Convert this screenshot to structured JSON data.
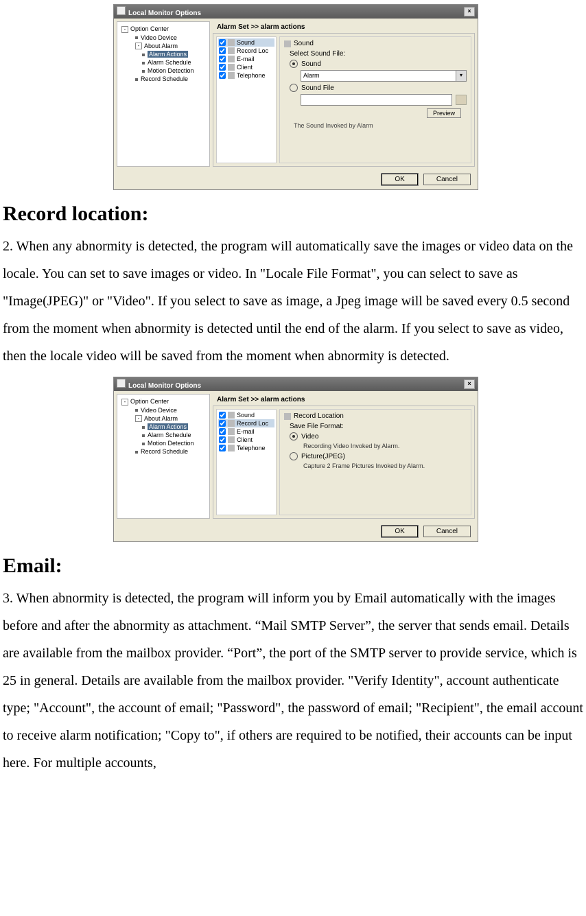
{
  "dialog1": {
    "title": "Local Monitor Options",
    "tree": {
      "root": "Option Center",
      "video_device": "Video Device",
      "about_alarm": "About Alarm",
      "alarm_actions": "Alarm Actions",
      "alarm_schedule": "Alarm Schedule",
      "motion_detection": "Motion Detection",
      "record_schedule": "Record Schedule"
    },
    "crumb": "Alarm Set >> alarm actions",
    "actions": {
      "sound": "Sound",
      "record": "Record Loc",
      "email": "E-mail",
      "client": "Client",
      "telephone": "Telephone"
    },
    "detail": {
      "title": "Sound",
      "select_label": "Select Sound File:",
      "opt_sound": "Sound",
      "sound_value": "Alarm",
      "opt_soundfile": "Sound File",
      "preview": "Preview",
      "hint": "The Sound Invoked by Alarm"
    },
    "buttons": {
      "ok": "OK",
      "cancel": "Cancel"
    }
  },
  "section1": {
    "heading": "Record location:",
    "text": "2.  When any abnormity is detected, the program will automatically save the images or video data on the locale. You can set to save images or video.   In \"Locale File Format\", you can select to save as \"Image(JPEG)\" or \"Video\". If you select to save as image, a Jpeg image will be saved every 0.5 second from the moment when abnormity is detected until the end of the alarm. If you select to save as video, then the locale video will be saved from the moment when abnormity is detected."
  },
  "dialog2": {
    "title": "Local Monitor Options",
    "crumb": "Alarm Set >> alarm actions",
    "detail": {
      "title": "Record Location",
      "save_format": "Save File Format:",
      "opt_video": "Video",
      "video_sub": "Recording Video Invoked by Alarm.",
      "opt_picture": "Picture(JPEG)",
      "picture_sub": "Capture 2 Frame Pictures Invoked by Alarm."
    },
    "buttons": {
      "ok": "OK",
      "cancel": "Cancel"
    }
  },
  "section2": {
    "heading": "Email:",
    "text": "3. When abnormity is detected, the program will inform you by Email automatically with the images before and after the abnormity as attachment. “Mail SMTP Server”, the server that sends email. Details are available from the mailbox provider. “Port”, the port of the SMTP server to provide service, which is 25 in general. Details are available from the mailbox provider. \"Verify Identity\", account authenticate type; \"Account\", the account of email; \"Password\", the password of email; \"Recipient\", the email account to receive alarm notification; \"Copy to\", if others are required to be notified, their accounts can be input here. For multiple accounts,"
  }
}
